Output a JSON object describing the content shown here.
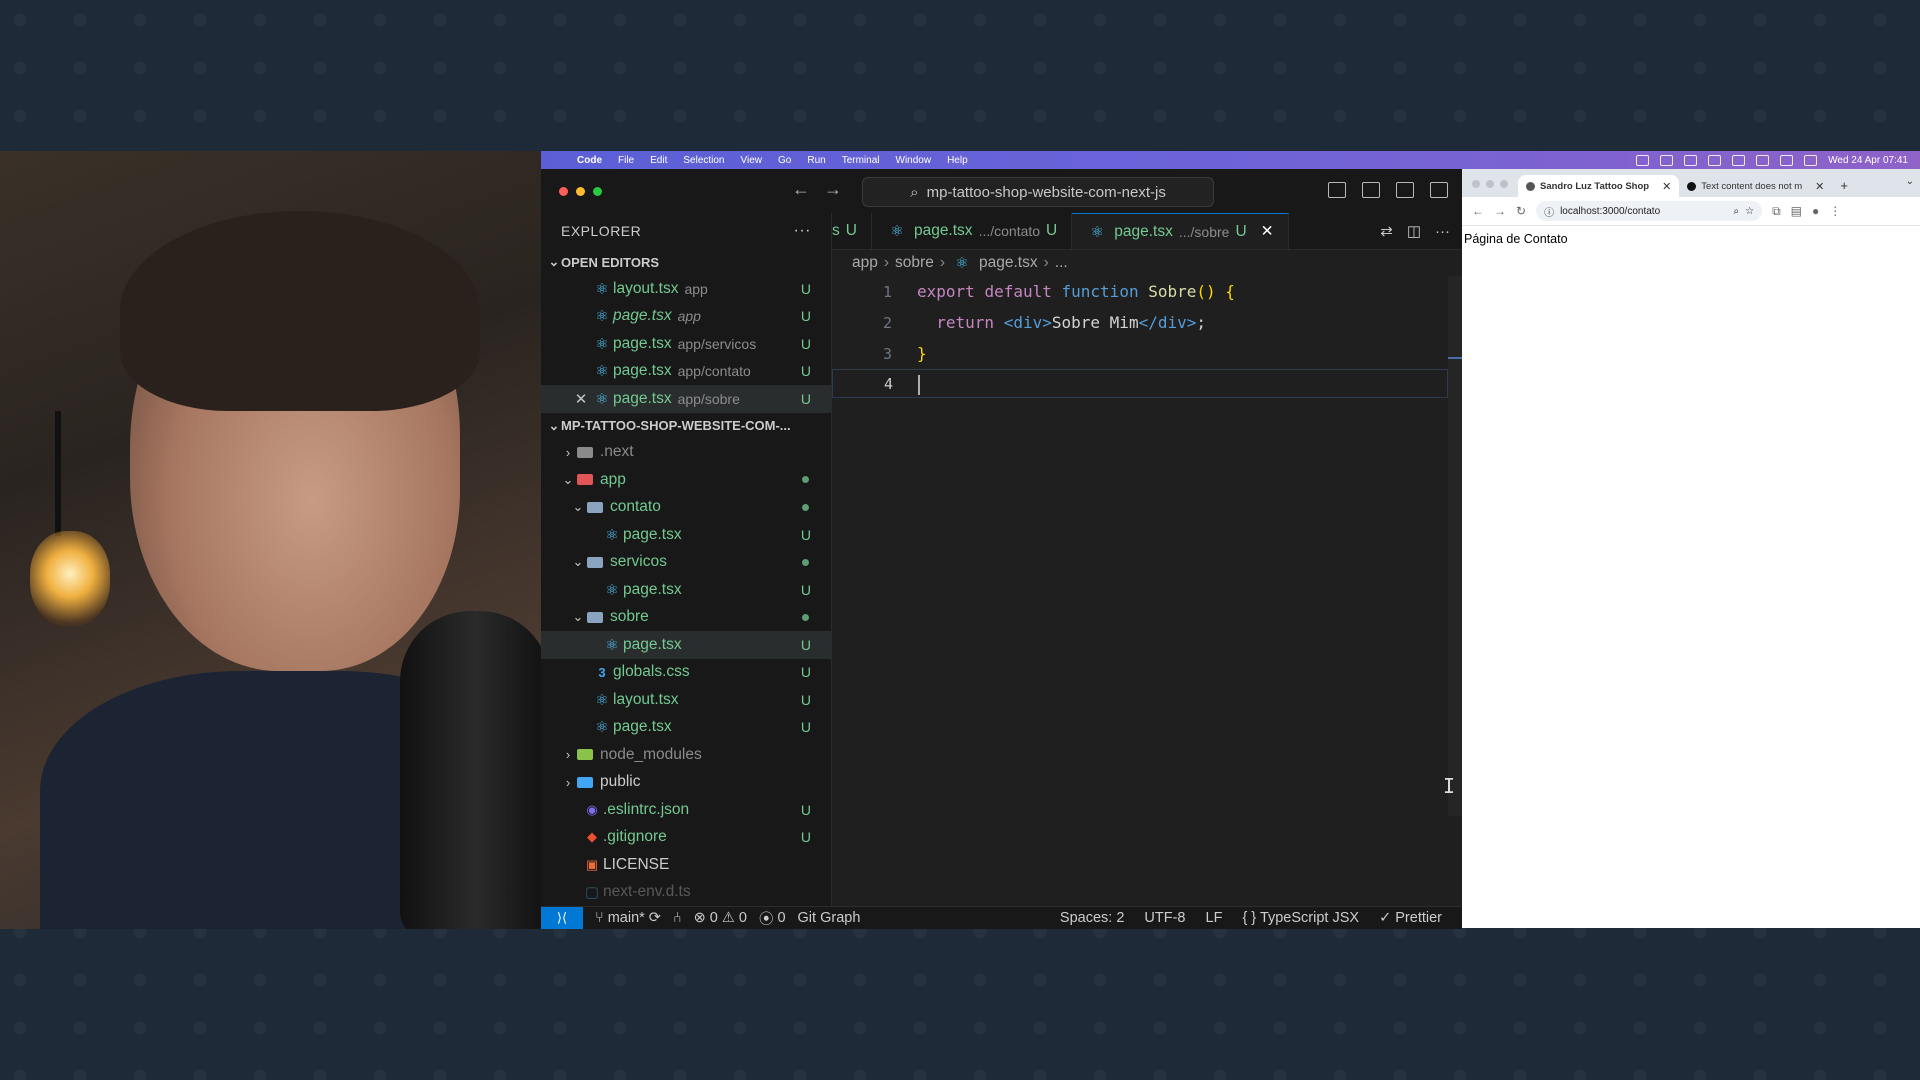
{
  "menubar": {
    "items": [
      "Code",
      "File",
      "Edit",
      "Selection",
      "View",
      "Go",
      "Run",
      "Terminal",
      "Window",
      "Help"
    ],
    "clock": "Wed 24 Apr 07:41"
  },
  "vscode": {
    "command_center": "mp-tattoo-shop-website-com-next-js",
    "explorer_title": "EXPLORER",
    "open_editors_title": "OPEN EDITORS",
    "open_editors": [
      {
        "name": "layout.tsx",
        "desc": "app",
        "status": "U"
      },
      {
        "name": "page.tsx",
        "desc": "app",
        "status": "U"
      },
      {
        "name": "page.tsx",
        "desc": "app/servicos",
        "status": "U"
      },
      {
        "name": "page.tsx",
        "desc": "app/contato",
        "status": "U"
      },
      {
        "name": "page.tsx",
        "desc": "app/sobre",
        "status": "U"
      }
    ],
    "project_title": "MP-TATTOO-SHOP-WEBSITE-COM-...",
    "tree": {
      "next": ".next",
      "app": "app",
      "contato": "contato",
      "contato_page": "page.tsx",
      "servicos": "servicos",
      "servicos_page": "page.tsx",
      "sobre": "sobre",
      "sobre_page": "page.tsx",
      "globals": "globals.css",
      "layout": "layout.tsx",
      "page": "page.tsx",
      "node_modules": "node_modules",
      "public": "public",
      "eslintrc": ".eslintrc.json",
      "gitignore": ".gitignore",
      "license": "LICENSE",
      "next_env": "next-env.d.ts",
      "status_u": "U"
    },
    "tabs": [
      {
        "prefix": "s",
        "status": "U"
      },
      {
        "name": "page.tsx",
        "desc": ".../contato",
        "status": "U"
      },
      {
        "name": "page.tsx",
        "desc": ".../sobre",
        "status": "U"
      }
    ],
    "breadcrumb": [
      "app",
      "sobre",
      "page.tsx",
      "..."
    ],
    "code": {
      "line_numbers": [
        "1",
        "2",
        "3",
        "4"
      ],
      "l1_kw1": "export",
      "l1_kw2": "default",
      "l1_kw3": "function",
      "l1_fn": "Sobre",
      "l1_paren": "()",
      "l1_brace": "{",
      "l2_kw": "return",
      "l2_open": "<div>",
      "l2_text": "Sobre Mim",
      "l2_close": "</div>",
      "l2_semi": ";",
      "l3_brace": "}"
    },
    "statusbar": {
      "branch": "main*",
      "errors": "0",
      "warnings": "0",
      "ports": "0",
      "git_graph": "Git Graph",
      "spaces": "Spaces: 2",
      "encoding": "UTF-8",
      "eol": "LF",
      "language": "TypeScript JSX",
      "formatter": "Prettier"
    }
  },
  "chrome": {
    "tabs": [
      {
        "title": "Sandro Luz Tattoo Shop"
      },
      {
        "title": "Text content does not m"
      }
    ],
    "url": "localhost:3000/contato",
    "page_text": "Página de Contato"
  }
}
